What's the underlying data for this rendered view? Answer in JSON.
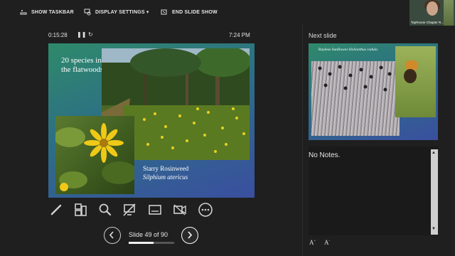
{
  "topbar": {
    "show_taskbar": "SHOW TASKBAR",
    "display_settings": "DISPLAY SETTINGS ▾",
    "end_slide_show": "END SLIDE SHOW",
    "video_caption": "TapRoone Chapter R..."
  },
  "presenter": {
    "timer": "0:15:28",
    "pause_icon": "❚❚",
    "restart_icon": "↻",
    "clock": "7:24 PM"
  },
  "current_slide": {
    "title": "20 species in the flatwoods",
    "caption_common": "Starry Rosinweed",
    "caption_latin": "Silphium atericus"
  },
  "tools": [
    "pen-icon",
    "see-all-slides-icon",
    "zoom-icon",
    "black-screen-icon",
    "subtitles-icon",
    "camera-off-icon",
    "more-options-icon"
  ],
  "navigation": {
    "slide_counter": "Slide 49 of 90",
    "progress": 0.544
  },
  "next_slide": {
    "label": "Next slide",
    "common": "Rayless Sunflower",
    "latin": "Helianthus radula"
  },
  "notes": {
    "text": "No Notes.",
    "increase_font": "A",
    "decrease_font": "A"
  },
  "colors": {
    "background": "#1f1f1f",
    "slide_gradient_start": "#2e8a6a",
    "slide_gradient_end": "#3a4fa0"
  }
}
